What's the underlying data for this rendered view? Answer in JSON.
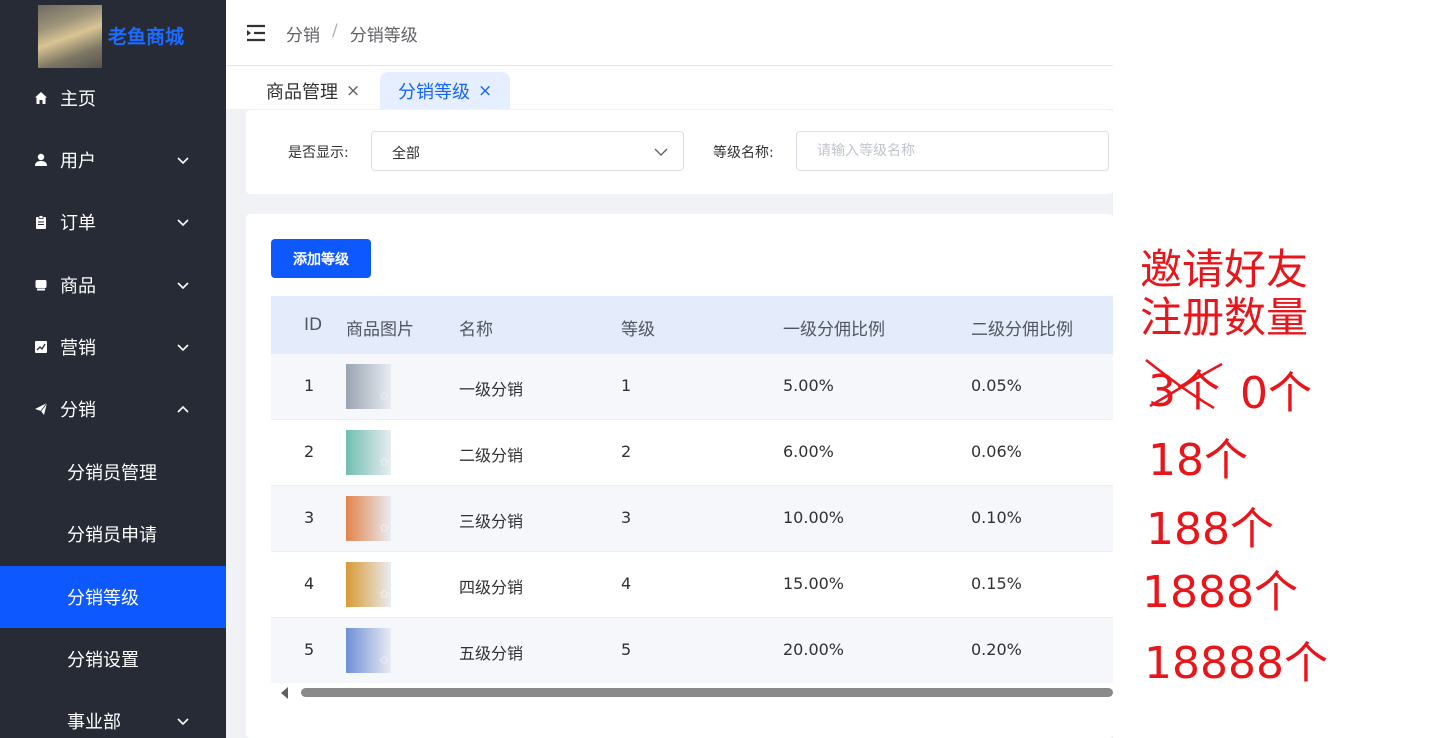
{
  "sidebar": {
    "logo_text": "老鱼商城",
    "menu": [
      {
        "label": "主页"
      },
      {
        "label": "用户"
      },
      {
        "label": "订单"
      },
      {
        "label": "商品"
      },
      {
        "label": "营销"
      },
      {
        "label": "分销"
      }
    ],
    "submenu": [
      {
        "label": "分销员管理"
      },
      {
        "label": "分销员申请"
      },
      {
        "label": "分销等级"
      },
      {
        "label": "分销设置"
      }
    ],
    "bottom_item": {
      "label": "事业部"
    },
    "active_submenu": "分销等级",
    "accent_color": "#0d58ff"
  },
  "header": {
    "breadcrumb": [
      "分销",
      "/",
      "分销等级"
    ]
  },
  "tabs": [
    {
      "label": "商品管理",
      "close": "×"
    },
    {
      "label": "分销等级",
      "close": "×",
      "active": true
    }
  ],
  "filter": {
    "show_label": "是否显示:",
    "show_value": "全部",
    "name_label": "等级名称:",
    "name_placeholder": "请输入等级名称"
  },
  "toolbar": {
    "add_label": "添加等级"
  },
  "table": {
    "columns": [
      "ID",
      "商品图片",
      "名称",
      "等级",
      "一级分佣比例",
      "二级分佣比例"
    ],
    "rows": [
      {
        "id": "1",
        "name": "一级分销",
        "level": "1",
        "rate1": "5.00%",
        "rate2": "0.05%",
        "thumb_color": "#9aa4b2"
      },
      {
        "id": "2",
        "name": "二级分销",
        "level": "2",
        "rate1": "6.00%",
        "rate2": "0.06%",
        "thumb_color": "#6fbfb0"
      },
      {
        "id": "3",
        "name": "三级分销",
        "level": "3",
        "rate1": "10.00%",
        "rate2": "0.10%",
        "thumb_color": "#e3834a"
      },
      {
        "id": "4",
        "name": "四级分销",
        "level": "4",
        "rate1": "15.00%",
        "rate2": "0.15%",
        "thumb_color": "#d99a35"
      },
      {
        "id": "5",
        "name": "五级分销",
        "level": "5",
        "rate1": "20.00%",
        "rate2": "0.20%",
        "thumb_color": "#6f8fd6"
      }
    ]
  },
  "annotation": {
    "title_line1": "邀请好友",
    "title_line2": "注册数量",
    "struck": "3个",
    "lines": [
      "0个",
      "18个",
      "188个",
      "1888个",
      "18888个"
    ],
    "color": "#e8151b"
  }
}
